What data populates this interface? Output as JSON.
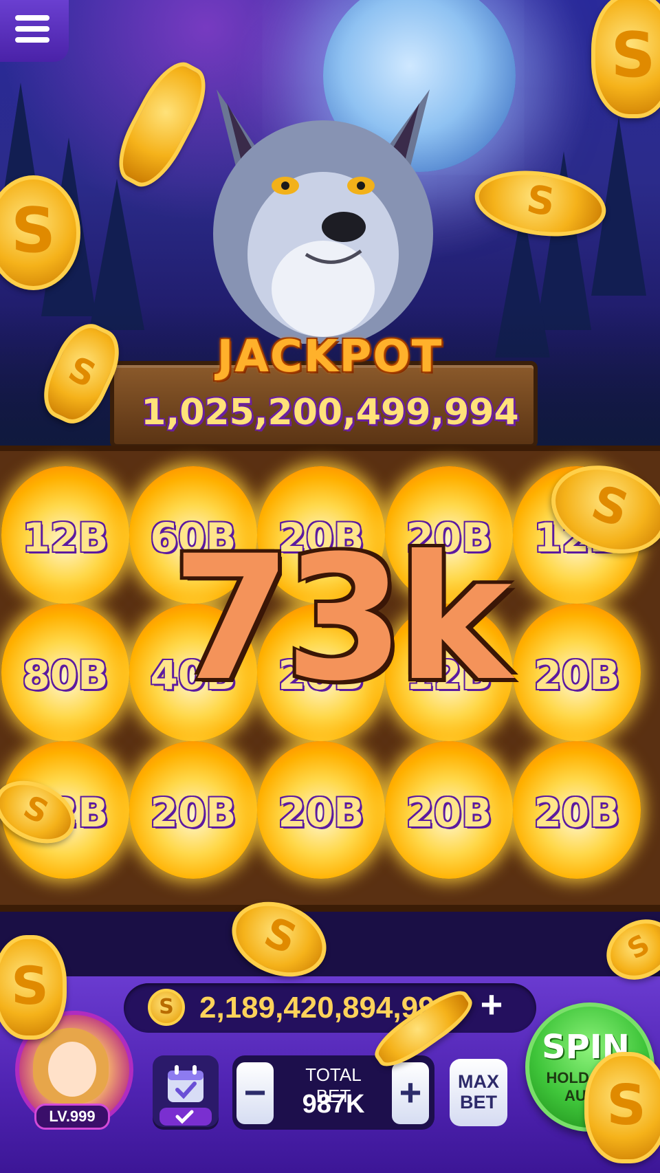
{
  "menu": {
    "icon": "hamburger-menu-icon"
  },
  "jackpot": {
    "title": "JACKPOT",
    "value": "1,025,200,499,994"
  },
  "board": {
    "rows": [
      [
        "12B",
        "60B",
        "20B",
        "20B",
        "12B"
      ],
      [
        "80B",
        "40B",
        "20B",
        "12B",
        "20B"
      ],
      [
        "12B",
        "20B",
        "20B",
        "20B",
        "20B"
      ]
    ]
  },
  "win_amount": "73k",
  "balance": {
    "value": "2,189,420,894,998",
    "coin_symbol": "S"
  },
  "player": {
    "level": "LV.999"
  },
  "bet": {
    "label": "TOTAL BET",
    "value": "987K",
    "minus": "−",
    "plus": "+"
  },
  "max_bet": {
    "line1": "MAX",
    "line2": "BET"
  },
  "spin": {
    "label": "SPIN",
    "sub_line1": "HOLD FOR",
    "sub_line2": "AUTO"
  },
  "colors": {
    "accent_purple": "#4e22b0",
    "gold": "#ffd35a",
    "spin_green": "#3fc53a"
  }
}
